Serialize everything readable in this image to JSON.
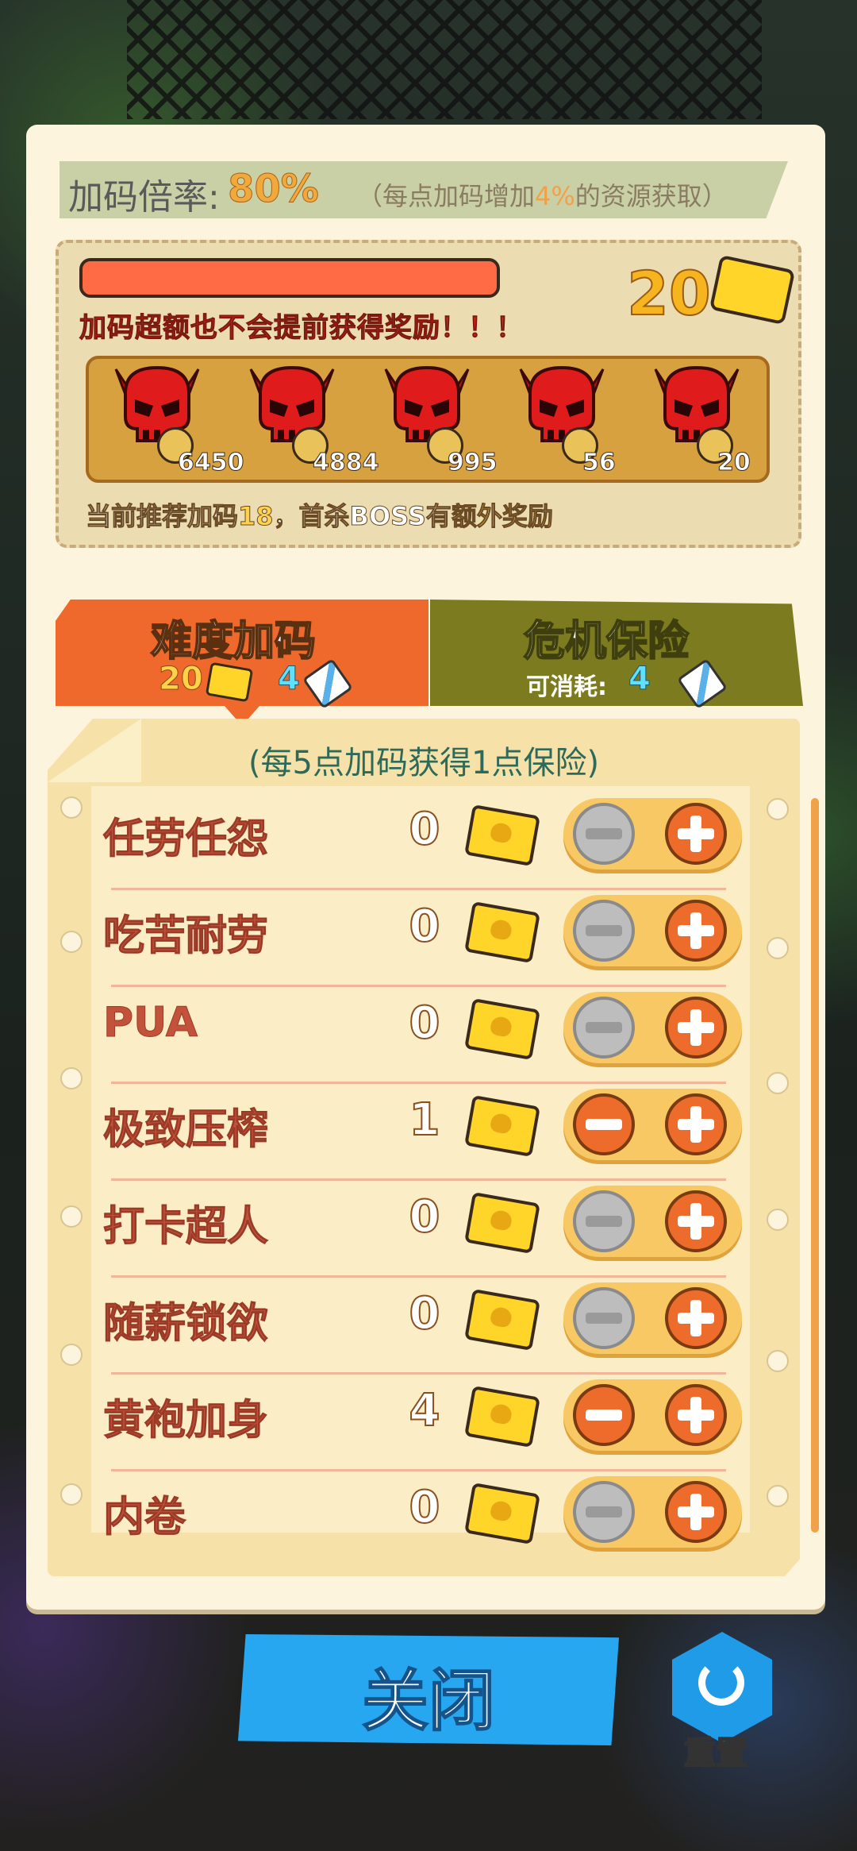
{
  "header": {
    "rate_label": "加码倍率:",
    "rate_value": "80%",
    "note_prefix": "（每点加码增加",
    "note_highlight": "4%",
    "note_suffix": "的资源获取）"
  },
  "reward": {
    "warning": "加码超额也不会提前获得奖励！！！",
    "coupon_count": "20",
    "progress_fraction": 1.0,
    "skulls": [
      {
        "icon": "pot-icon",
        "count": "6450"
      },
      {
        "icon": "screw-icon",
        "count": "4884"
      },
      {
        "icon": "battery-icon",
        "count": "995"
      },
      {
        "icon": "potion-icon",
        "count": "56"
      },
      {
        "icon": "crown-icon",
        "count": "20"
      }
    ],
    "rec_prefix": "当前推荐加码",
    "rec_value": "18",
    "rec_mid": "，首杀BOSS有",
    "rec_highlight": "额外奖励"
  },
  "tabs": {
    "left_title": "难度加码",
    "left_coupons": "20",
    "left_insurance": "4",
    "right_title": "危机保险",
    "right_sub_label": "可消耗:",
    "right_insurance": "4"
  },
  "list": {
    "header": "(每5点加码获得1点保险)",
    "items": [
      {
        "label": "任劳任怨",
        "value": "0",
        "minus_enabled": false
      },
      {
        "label": "吃苦耐劳",
        "value": "0",
        "minus_enabled": false
      },
      {
        "label": "PUA",
        "value": "0",
        "minus_enabled": false
      },
      {
        "label": "极致压榨",
        "value": "1",
        "minus_enabled": true
      },
      {
        "label": "打卡超人",
        "value": "0",
        "minus_enabled": false
      },
      {
        "label": "随薪锁欲",
        "value": "0",
        "minus_enabled": false
      },
      {
        "label": "黄袍加身",
        "value": "4",
        "minus_enabled": true
      },
      {
        "label": "内卷",
        "value": "0",
        "minus_enabled": false
      }
    ]
  },
  "footer": {
    "close_label": "关闭",
    "reset_label": "重置"
  },
  "colors": {
    "accent_orange": "#f0692c",
    "tab_olive": "#7c7b1f",
    "close_blue": "#27a7ef",
    "coupon_yellow": "#ffd52a"
  }
}
